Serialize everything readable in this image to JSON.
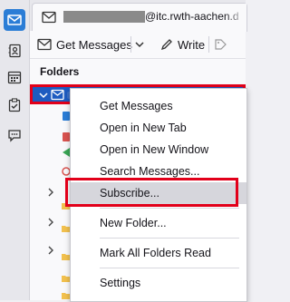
{
  "tab": {
    "title_suffix": "@itc.rwth-aachen.d"
  },
  "toolbar": {
    "get_messages": "Get Messages",
    "write": "Write"
  },
  "folder_pane": {
    "title": "Folders"
  },
  "context_menu": {
    "items": [
      "Get Messages",
      "Open in New Tab",
      "Open in New Window",
      "Search Messages...",
      "Subscribe...",
      "New Folder...",
      "Mark All Folders Read",
      "Settings"
    ],
    "highlighted": "Subscribe..."
  },
  "colors": {
    "accent": "#2b7dd6",
    "selection": "#1e5bc0",
    "annotation": "#e2001a"
  },
  "icons": [
    "mail-icon",
    "address-book-icon",
    "calendar-icon",
    "tasks-icon",
    "chat-icon",
    "envelope-icon",
    "chevron-down-icon",
    "pencil-icon",
    "tag-icon",
    "folder-icon"
  ]
}
